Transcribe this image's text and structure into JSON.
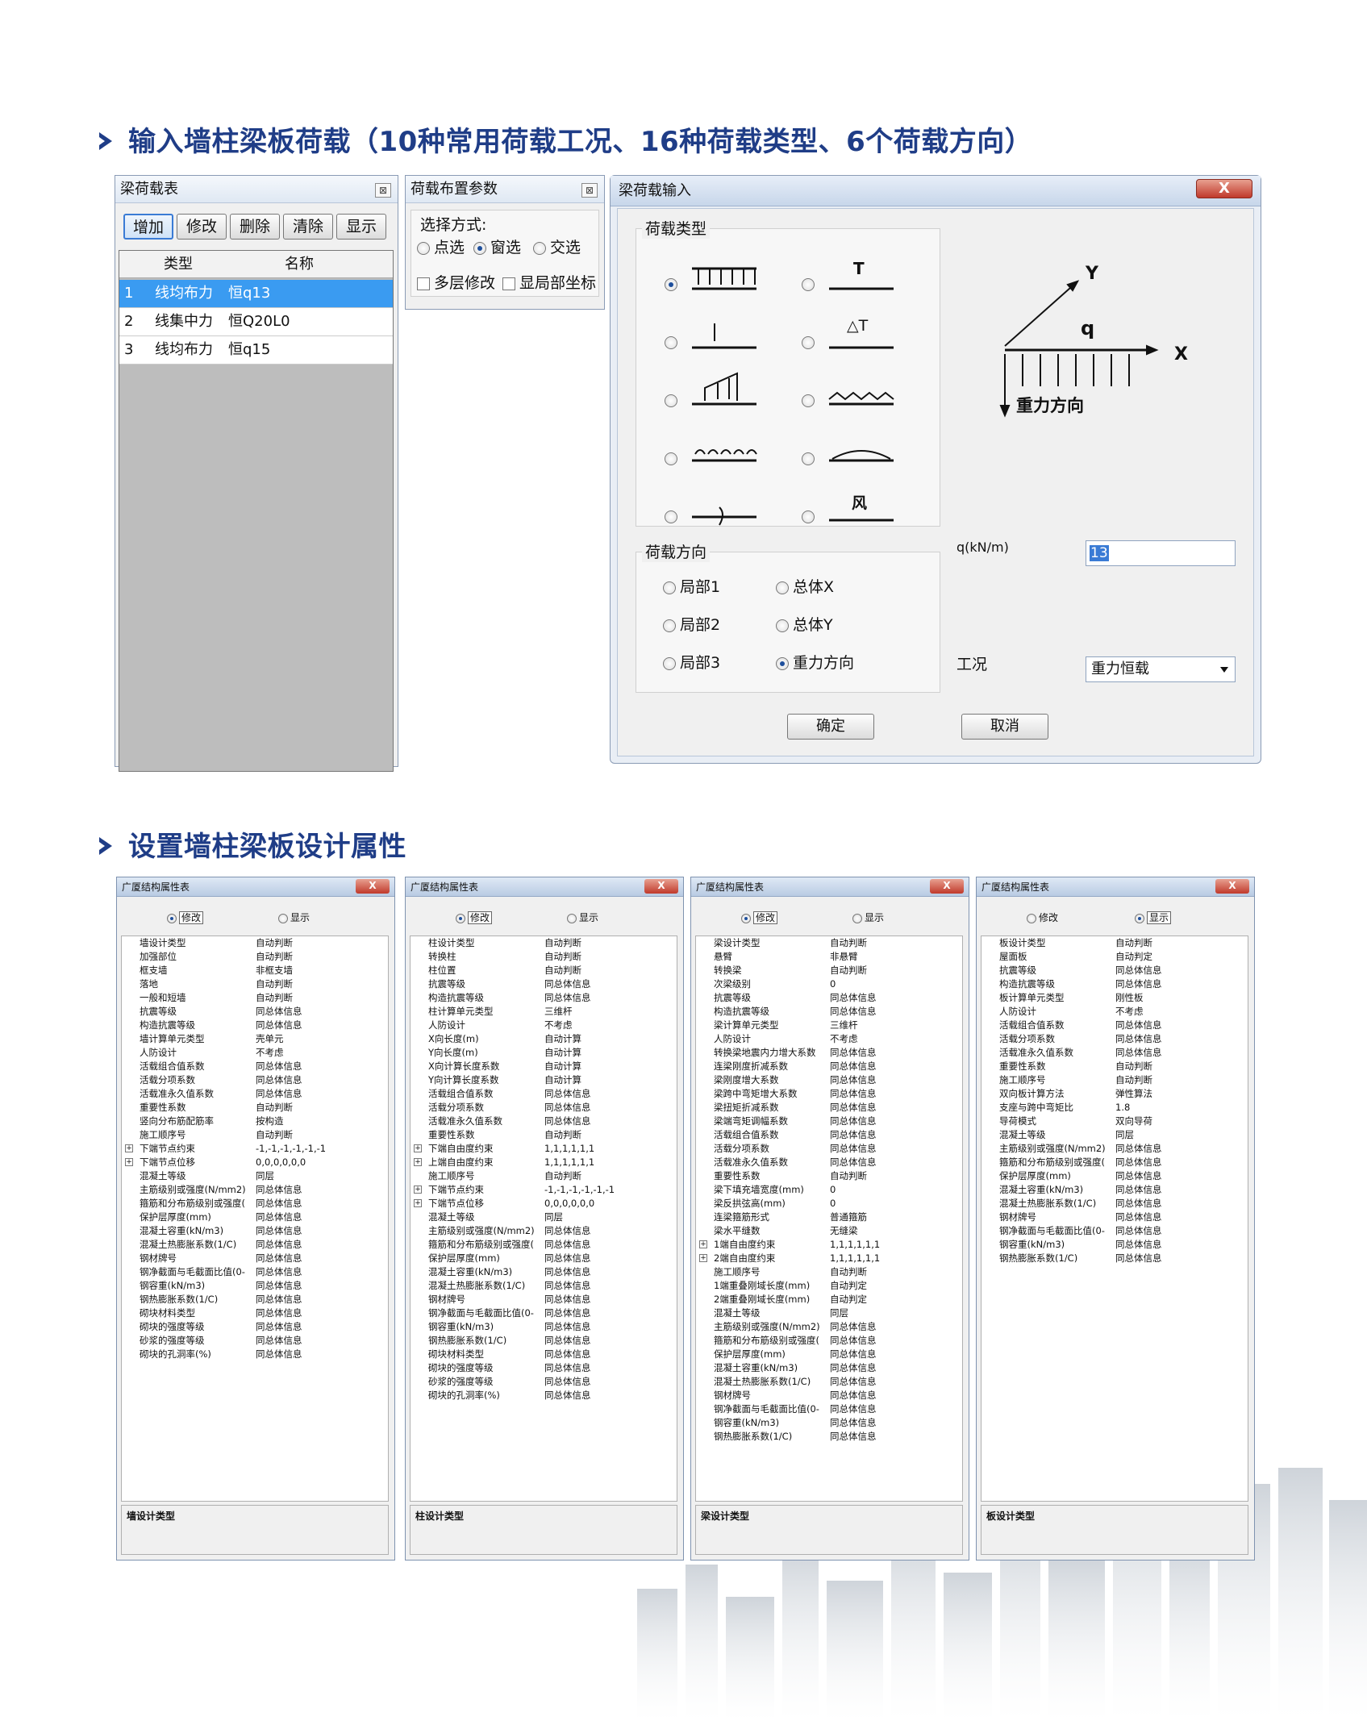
{
  "headings": {
    "h1": "输入墙柱梁板荷载（10种常用荷载工况、16种荷载类型、6个荷载方向）",
    "h2": "设置墙柱梁板设计属性"
  },
  "beam_load_table": {
    "title": "梁荷载表",
    "buttons": [
      "增加",
      "修改",
      "删除",
      "清除",
      "显示"
    ],
    "columns": [
      "类型",
      "名称"
    ],
    "rows": [
      {
        "no": "1",
        "type": "线均布力",
        "name": "恒q13"
      },
      {
        "no": "2",
        "type": "线集中力",
        "name": "恒Q20L0"
      },
      {
        "no": "3",
        "type": "线均布力",
        "name": "恒q15"
      }
    ]
  },
  "load_params": {
    "title": "荷载布置参数",
    "select_label": "选择方式:",
    "options": [
      "点选",
      "窗选",
      "交选"
    ],
    "selected": "窗选",
    "checks": [
      "多层修改",
      "显局部坐标"
    ]
  },
  "beam_load_input": {
    "title": "梁荷载输入",
    "close": "X",
    "load_type_label": "荷载类型",
    "glyph_T": "T",
    "glyph_dT": "△T",
    "glyph_wind": "风",
    "direction_label": "荷载方向",
    "directions": [
      "局部1",
      "总体X",
      "局部2",
      "总体Y",
      "局部3",
      "重力方向"
    ],
    "selected_direction": "重力方向",
    "q_label": "q(kN/m)",
    "q_value": "13",
    "case_label": "工况",
    "case_value": "重力恒载",
    "ok": "确定",
    "cancel": "取消",
    "diagram": {
      "y": "Y",
      "x": "X",
      "q": "q",
      "gravity": "重力方向"
    }
  },
  "property_windows": [
    {
      "title": "广厦结构属性表",
      "mode_modify": "修改",
      "mode_show": "显示",
      "active": "modify",
      "desc": "墙设计类型",
      "rows": [
        [
          "",
          "墙设计类型",
          "自动判断"
        ],
        [
          "",
          "加强部位",
          "自动判断"
        ],
        [
          "",
          "框支墙",
          "非框支墙"
        ],
        [
          "",
          "落地",
          "自动判断"
        ],
        [
          "",
          "一般和短墙",
          "自动判断"
        ],
        [
          "",
          "抗震等级",
          "同总体信息"
        ],
        [
          "",
          "构造抗震等级",
          "同总体信息"
        ],
        [
          "",
          "墙计算单元类型",
          "壳单元"
        ],
        [
          "",
          "人防设计",
          "不考虑"
        ],
        [
          "",
          "活载组合值系数",
          "同总体信息"
        ],
        [
          "",
          "活载分项系数",
          "同总体信息"
        ],
        [
          "",
          "活载准永久值系数",
          "同总体信息"
        ],
        [
          "",
          "重要性系数",
          "自动判断"
        ],
        [
          "",
          "竖向分布筋配筋率",
          "按构造"
        ],
        [
          "",
          "施工顺序号",
          "自动判断"
        ],
        [
          "+",
          "下端节点约束",
          "-1,-1,-1,-1,-1,-1"
        ],
        [
          "+",
          "下端节点位移",
          "0,0,0,0,0,0"
        ],
        [
          "",
          "混凝土等级",
          "同层"
        ],
        [
          "",
          "主筋级别或强度(N/mm2)",
          "同总体信息"
        ],
        [
          "",
          "箍筋和分布筋级别或强度(",
          "同总体信息"
        ],
        [
          "",
          "保护层厚度(mm)",
          "同总体信息"
        ],
        [
          "",
          "混凝土容重(kN/m3)",
          "同总体信息"
        ],
        [
          "",
          "混凝土热膨胀系数(1/C)",
          "同总体信息"
        ],
        [
          "",
          "钢材牌号",
          "同总体信息"
        ],
        [
          "",
          "钢净截面与毛截面比值(0-",
          "同总体信息"
        ],
        [
          "",
          "钢容重(kN/m3)",
          "同总体信息"
        ],
        [
          "",
          "钢热膨胀系数(1/C)",
          "同总体信息"
        ],
        [
          "",
          "砌块材料类型",
          "同总体信息"
        ],
        [
          "",
          "砌块的强度等级",
          "同总体信息"
        ],
        [
          "",
          "砂浆的强度等级",
          "同总体信息"
        ],
        [
          "",
          "砌块的孔洞率(%)",
          "同总体信息"
        ]
      ]
    },
    {
      "title": "广厦结构属性表",
      "mode_modify": "修改",
      "mode_show": "显示",
      "active": "modify",
      "desc": "柱设计类型",
      "rows": [
        [
          "",
          "柱设计类型",
          "自动判断"
        ],
        [
          "",
          "转换柱",
          "自动判断"
        ],
        [
          "",
          "柱位置",
          "自动判断"
        ],
        [
          "",
          "抗震等级",
          "同总体信息"
        ],
        [
          "",
          "构造抗震等级",
          "同总体信息"
        ],
        [
          "",
          "柱计算单元类型",
          "三维杆"
        ],
        [
          "",
          "人防设计",
          "不考虑"
        ],
        [
          "",
          "X向长度(m)",
          "自动计算"
        ],
        [
          "",
          "Y向长度(m)",
          "自动计算"
        ],
        [
          "",
          "X向计算长度系数",
          "自动计算"
        ],
        [
          "",
          "Y向计算长度系数",
          "自动计算"
        ],
        [
          "",
          "活载组合值系数",
          "同总体信息"
        ],
        [
          "",
          "活载分项系数",
          "同总体信息"
        ],
        [
          "",
          "活载准永久值系数",
          "同总体信息"
        ],
        [
          "",
          "重要性系数",
          "自动判断"
        ],
        [
          "+",
          "下端自由度约束",
          "1,1,1,1,1,1"
        ],
        [
          "+",
          "上端自由度约束",
          "1,1,1,1,1,1"
        ],
        [
          "",
          "施工顺序号",
          "自动判断"
        ],
        [
          "+",
          "下端节点约束",
          "-1,-1,-1,-1,-1,-1"
        ],
        [
          "+",
          "下端节点位移",
          "0,0,0,0,0,0"
        ],
        [
          "",
          "混凝土等级",
          "同层"
        ],
        [
          "",
          "主筋级别或强度(N/mm2)",
          "同总体信息"
        ],
        [
          "",
          "箍筋和分布筋级别或强度(",
          "同总体信息"
        ],
        [
          "",
          "保护层厚度(mm)",
          "同总体信息"
        ],
        [
          "",
          "混凝土容重(kN/m3)",
          "同总体信息"
        ],
        [
          "",
          "混凝土热膨胀系数(1/C)",
          "同总体信息"
        ],
        [
          "",
          "钢材牌号",
          "同总体信息"
        ],
        [
          "",
          "钢净截面与毛截面比值(0-",
          "同总体信息"
        ],
        [
          "",
          "钢容重(kN/m3)",
          "同总体信息"
        ],
        [
          "",
          "钢热膨胀系数(1/C)",
          "同总体信息"
        ],
        [
          "",
          "砌块材料类型",
          "同总体信息"
        ],
        [
          "",
          "砌块的强度等级",
          "同总体信息"
        ],
        [
          "",
          "砂浆的强度等级",
          "同总体信息"
        ],
        [
          "",
          "砌块的孔洞率(%)",
          "同总体信息"
        ]
      ]
    },
    {
      "title": "广厦结构属性表",
      "mode_modify": "修改",
      "mode_show": "显示",
      "active": "modify",
      "desc": "梁设计类型",
      "rows": [
        [
          "",
          "梁设计类型",
          "自动判断"
        ],
        [
          "",
          "悬臂",
          "非悬臂"
        ],
        [
          "",
          "转换梁",
          "自动判断"
        ],
        [
          "",
          "次梁级别",
          "0"
        ],
        [
          "",
          "抗震等级",
          "同总体信息"
        ],
        [
          "",
          "构造抗震等级",
          "同总体信息"
        ],
        [
          "",
          "梁计算单元类型",
          "三维杆"
        ],
        [
          "",
          "人防设计",
          "不考虑"
        ],
        [
          "",
          "转换梁地震内力增大系数",
          "同总体信息"
        ],
        [
          "",
          "连梁刚度折减系数",
          "同总体信息"
        ],
        [
          "",
          "梁刚度增大系数",
          "同总体信息"
        ],
        [
          "",
          "梁跨中弯矩增大系数",
          "同总体信息"
        ],
        [
          "",
          "梁扭矩折减系数",
          "同总体信息"
        ],
        [
          "",
          "梁端弯矩调幅系数",
          "同总体信息"
        ],
        [
          "",
          "活载组合值系数",
          "同总体信息"
        ],
        [
          "",
          "活载分项系数",
          "同总体信息"
        ],
        [
          "",
          "活载准永久值系数",
          "同总体信息"
        ],
        [
          "",
          "重要性系数",
          "自动判断"
        ],
        [
          "",
          "梁下填充墙宽度(mm)",
          "0"
        ],
        [
          "",
          "梁反拱弦高(mm)",
          "0"
        ],
        [
          "",
          "连梁箍筋形式",
          "普通箍筋"
        ],
        [
          "",
          "梁水平缝数",
          "无缝梁"
        ],
        [
          "+",
          "1端自由度约束",
          "1,1,1,1,1,1"
        ],
        [
          "+",
          "2端自由度约束",
          "1,1,1,1,1,1"
        ],
        [
          "",
          "施工顺序号",
          "自动判断"
        ],
        [
          "",
          "1端重叠刚域长度(mm)",
          "自动判定"
        ],
        [
          "",
          "2端重叠刚域长度(mm)",
          "自动判定"
        ],
        [
          "",
          "混凝土等级",
          "同层"
        ],
        [
          "",
          "主筋级别或强度(N/mm2)",
          "同总体信息"
        ],
        [
          "",
          "箍筋和分布筋级别或强度(",
          "同总体信息"
        ],
        [
          "",
          "保护层厚度(mm)",
          "同总体信息"
        ],
        [
          "",
          "混凝土容重(kN/m3)",
          "同总体信息"
        ],
        [
          "",
          "混凝土热膨胀系数(1/C)",
          "同总体信息"
        ],
        [
          "",
          "钢材牌号",
          "同总体信息"
        ],
        [
          "",
          "钢净截面与毛截面比值(0-",
          "同总体信息"
        ],
        [
          "",
          "钢容重(kN/m3)",
          "同总体信息"
        ],
        [
          "",
          "钢热膨胀系数(1/C)",
          "同总体信息"
        ]
      ]
    },
    {
      "title": "广厦结构属性表",
      "mode_modify": "修改",
      "mode_show": "显示",
      "active": "show",
      "desc": "板设计类型",
      "rows": [
        [
          "",
          "板设计类型",
          "自动判断"
        ],
        [
          "",
          "屋面板",
          "自动判定"
        ],
        [
          "",
          "抗震等级",
          "同总体信息"
        ],
        [
          "",
          "构造抗震等级",
          "同总体信息"
        ],
        [
          "",
          "板计算单元类型",
          "刚性板"
        ],
        [
          "",
          "人防设计",
          "不考虑"
        ],
        [
          "",
          "活载组合值系数",
          "同总体信息"
        ],
        [
          "",
          "活载分项系数",
          "同总体信息"
        ],
        [
          "",
          "活载准永久值系数",
          "同总体信息"
        ],
        [
          "",
          "重要性系数",
          "自动判断"
        ],
        [
          "",
          "施工顺序号",
          "自动判断"
        ],
        [
          "",
          "双向板计算方法",
          "弹性算法"
        ],
        [
          "",
          "支座与跨中弯矩比",
          "1.8"
        ],
        [
          "",
          "导荷模式",
          "双向导荷"
        ],
        [
          "",
          "混凝土等级",
          "同层"
        ],
        [
          "",
          "主筋级别或强度(N/mm2)",
          "同总体信息"
        ],
        [
          "",
          "箍筋和分布筋级别或强度(",
          "同总体信息"
        ],
        [
          "",
          "保护层厚度(mm)",
          "同总体信息"
        ],
        [
          "",
          "混凝土容重(kN/m3)",
          "同总体信息"
        ],
        [
          "",
          "混凝土热膨胀系数(1/C)",
          "同总体信息"
        ],
        [
          "",
          "钢材牌号",
          "同总体信息"
        ],
        [
          "",
          "钢净截面与毛截面比值(0-",
          "同总体信息"
        ],
        [
          "",
          "钢容重(kN/m3)",
          "同总体信息"
        ],
        [
          "",
          "钢热膨胀系数(1/C)",
          "同总体信息"
        ]
      ]
    }
  ]
}
